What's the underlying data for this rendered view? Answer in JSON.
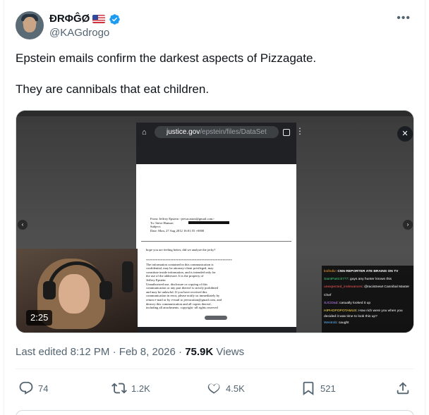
{
  "author": {
    "display_name": "ĐRΦĜØ",
    "handle": "@KAGdrogo",
    "flag_icon": "us-flag-icon",
    "verified_color": "#1d9bf0"
  },
  "tweet": {
    "text": "Epstein emails confirm the darkest aspects of Pizzagate.\n\nThey are cannibals that eat children."
  },
  "media": {
    "browser": {
      "url_domain": "justice.gov",
      "url_path": "/epstein/files/DataSet"
    },
    "document": {
      "header": "From: Jeffrey Epstein <jeevacation@gmail.com>\nTo: Steve Hanson\nSubject:\nDate: Mon, 27 Aug 2012 16:01:55 +0000",
      "body_first": "hope you are feeling better, did we analyze the jerky?",
      "body_main": "*****************************************************\nThe information contained in this communication is\nconfidential, may be attorney-client privileged, may\nconstitute inside information, and is intended only for\nthe use of the addressee. It is the property of\nJeffrey Epstein\nUnauthorized use, disclosure or copying of this\ncommunication or any part thereof is strictly prohibited\nand may be unlawful. If you have received this\ncommunication in error, please notify us immediately by\nreturn e-mail or by e-mail to jeevacation@gmail.com, and\ndestroy this communication and all copies thereof,\nincluding all attachments. copyright -all rights reserved"
    },
    "chat": [
      {
        "user": "knifediv",
        "msg": "CNN REPORTER ATE BRAINS ON TV"
      },
      {
        "user": "SaintPatrick777",
        "msg": "guys any hunter knows this"
      },
      {
        "user": "unexpected_irrelevances",
        "msg": "@racistnewt Cannibal Master Chef"
      },
      {
        "user": "SJCiDad",
        "msg": "casually looked it up"
      },
      {
        "user": "HIPHOPOPOTAMUS",
        "msg": "How rich were you when you decided it was time to look this up?"
      },
      {
        "user": "Westrob",
        "msg": "caught"
      }
    ],
    "duration": "2:25"
  },
  "meta": {
    "edited_prefix": "Last edited",
    "time": "8:12 PM",
    "date": "Feb 8, 2026",
    "views_count": "75.9K",
    "views_label": "Views"
  },
  "actions": {
    "replies": "74",
    "reposts": "1.2K",
    "likes": "4.5K",
    "bookmarks": "521"
  }
}
